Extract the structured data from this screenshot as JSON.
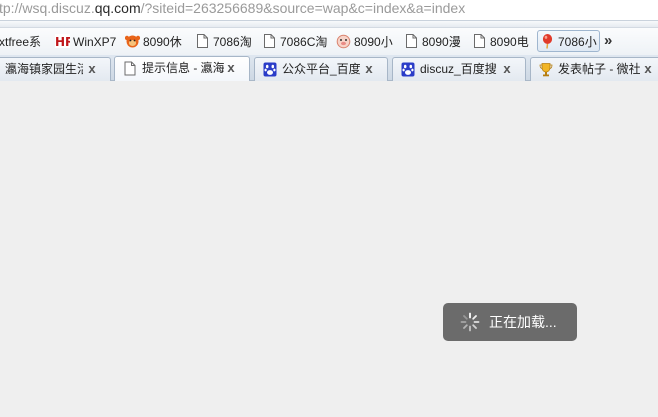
{
  "address_bar": {
    "url_prefix": "tp://wsq.discuz.",
    "url_host": "qq.com",
    "url_suffix": "/?siteid=263256689&source=wap&c=index&a=index"
  },
  "bookmarks": [
    {
      "label": "xtfree系",
      "icon": "none"
    },
    {
      "label": "WinXP7",
      "icon": "hr-logo-icon"
    },
    {
      "label": "8090休",
      "icon": "monkey-icon"
    },
    {
      "label": "7086淘",
      "icon": "page-icon"
    },
    {
      "label": "7086C淘",
      "icon": "page-icon"
    },
    {
      "label": "8090小",
      "icon": "pig-face-icon"
    },
    {
      "label": "8090漫",
      "icon": "page-icon"
    },
    {
      "label": "8090电",
      "icon": "page-icon"
    },
    {
      "label": "7086小",
      "icon": "balloon-icon"
    }
  ],
  "more_bookmarks": "»",
  "tabs": [
    {
      "title": "瀛海镇家园生活",
      "icon": "none",
      "active": false
    },
    {
      "title": "提示信息 - 瀛海",
      "icon": "page-icon",
      "active": true
    },
    {
      "title": "公众平台_百度",
      "icon": "baidu-paw-icon",
      "active": false
    },
    {
      "title": "discuz_百度搜",
      "icon": "baidu-paw-icon",
      "active": false
    },
    {
      "title": "发表帖子 - 微社",
      "icon": "trophy-icon",
      "active": false
    }
  ],
  "tab_close_glyph": "x",
  "loading": {
    "text": "正在加载..."
  },
  "colors": {
    "page_background": "#efefef",
    "toast_background": "#6b6b6b",
    "baidu_blue": "#2a3cc8"
  }
}
